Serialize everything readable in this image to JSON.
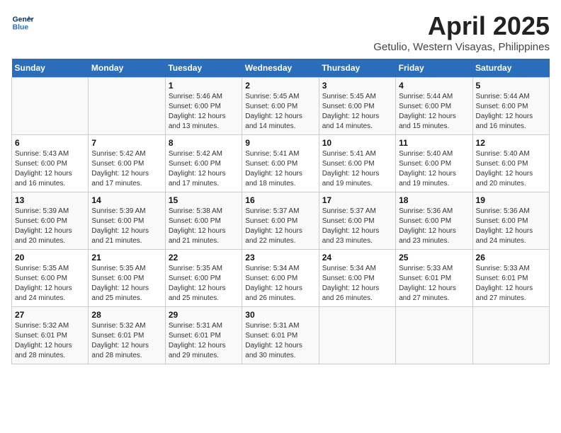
{
  "header": {
    "logo_line1": "General",
    "logo_line2": "Blue",
    "title": "April 2025",
    "subtitle": "Getulio, Western Visayas, Philippines"
  },
  "days_of_week": [
    "Sunday",
    "Monday",
    "Tuesday",
    "Wednesday",
    "Thursday",
    "Friday",
    "Saturday"
  ],
  "weeks": [
    [
      {
        "day": "",
        "info": ""
      },
      {
        "day": "",
        "info": ""
      },
      {
        "day": "1",
        "info": "Sunrise: 5:46 AM\nSunset: 6:00 PM\nDaylight: 12 hours and 13 minutes."
      },
      {
        "day": "2",
        "info": "Sunrise: 5:45 AM\nSunset: 6:00 PM\nDaylight: 12 hours and 14 minutes."
      },
      {
        "day": "3",
        "info": "Sunrise: 5:45 AM\nSunset: 6:00 PM\nDaylight: 12 hours and 14 minutes."
      },
      {
        "day": "4",
        "info": "Sunrise: 5:44 AM\nSunset: 6:00 PM\nDaylight: 12 hours and 15 minutes."
      },
      {
        "day": "5",
        "info": "Sunrise: 5:44 AM\nSunset: 6:00 PM\nDaylight: 12 hours and 16 minutes."
      }
    ],
    [
      {
        "day": "6",
        "info": "Sunrise: 5:43 AM\nSunset: 6:00 PM\nDaylight: 12 hours and 16 minutes."
      },
      {
        "day": "7",
        "info": "Sunrise: 5:42 AM\nSunset: 6:00 PM\nDaylight: 12 hours and 17 minutes."
      },
      {
        "day": "8",
        "info": "Sunrise: 5:42 AM\nSunset: 6:00 PM\nDaylight: 12 hours and 17 minutes."
      },
      {
        "day": "9",
        "info": "Sunrise: 5:41 AM\nSunset: 6:00 PM\nDaylight: 12 hours and 18 minutes."
      },
      {
        "day": "10",
        "info": "Sunrise: 5:41 AM\nSunset: 6:00 PM\nDaylight: 12 hours and 19 minutes."
      },
      {
        "day": "11",
        "info": "Sunrise: 5:40 AM\nSunset: 6:00 PM\nDaylight: 12 hours and 19 minutes."
      },
      {
        "day": "12",
        "info": "Sunrise: 5:40 AM\nSunset: 6:00 PM\nDaylight: 12 hours and 20 minutes."
      }
    ],
    [
      {
        "day": "13",
        "info": "Sunrise: 5:39 AM\nSunset: 6:00 PM\nDaylight: 12 hours and 20 minutes."
      },
      {
        "day": "14",
        "info": "Sunrise: 5:39 AM\nSunset: 6:00 PM\nDaylight: 12 hours and 21 minutes."
      },
      {
        "day": "15",
        "info": "Sunrise: 5:38 AM\nSunset: 6:00 PM\nDaylight: 12 hours and 21 minutes."
      },
      {
        "day": "16",
        "info": "Sunrise: 5:37 AM\nSunset: 6:00 PM\nDaylight: 12 hours and 22 minutes."
      },
      {
        "day": "17",
        "info": "Sunrise: 5:37 AM\nSunset: 6:00 PM\nDaylight: 12 hours and 23 minutes."
      },
      {
        "day": "18",
        "info": "Sunrise: 5:36 AM\nSunset: 6:00 PM\nDaylight: 12 hours and 23 minutes."
      },
      {
        "day": "19",
        "info": "Sunrise: 5:36 AM\nSunset: 6:00 PM\nDaylight: 12 hours and 24 minutes."
      }
    ],
    [
      {
        "day": "20",
        "info": "Sunrise: 5:35 AM\nSunset: 6:00 PM\nDaylight: 12 hours and 24 minutes."
      },
      {
        "day": "21",
        "info": "Sunrise: 5:35 AM\nSunset: 6:00 PM\nDaylight: 12 hours and 25 minutes."
      },
      {
        "day": "22",
        "info": "Sunrise: 5:35 AM\nSunset: 6:00 PM\nDaylight: 12 hours and 25 minutes."
      },
      {
        "day": "23",
        "info": "Sunrise: 5:34 AM\nSunset: 6:00 PM\nDaylight: 12 hours and 26 minutes."
      },
      {
        "day": "24",
        "info": "Sunrise: 5:34 AM\nSunset: 6:00 PM\nDaylight: 12 hours and 26 minutes."
      },
      {
        "day": "25",
        "info": "Sunrise: 5:33 AM\nSunset: 6:01 PM\nDaylight: 12 hours and 27 minutes."
      },
      {
        "day": "26",
        "info": "Sunrise: 5:33 AM\nSunset: 6:01 PM\nDaylight: 12 hours and 27 minutes."
      }
    ],
    [
      {
        "day": "27",
        "info": "Sunrise: 5:32 AM\nSunset: 6:01 PM\nDaylight: 12 hours and 28 minutes."
      },
      {
        "day": "28",
        "info": "Sunrise: 5:32 AM\nSunset: 6:01 PM\nDaylight: 12 hours and 28 minutes."
      },
      {
        "day": "29",
        "info": "Sunrise: 5:31 AM\nSunset: 6:01 PM\nDaylight: 12 hours and 29 minutes."
      },
      {
        "day": "30",
        "info": "Sunrise: 5:31 AM\nSunset: 6:01 PM\nDaylight: 12 hours and 30 minutes."
      },
      {
        "day": "",
        "info": ""
      },
      {
        "day": "",
        "info": ""
      },
      {
        "day": "",
        "info": ""
      }
    ]
  ]
}
